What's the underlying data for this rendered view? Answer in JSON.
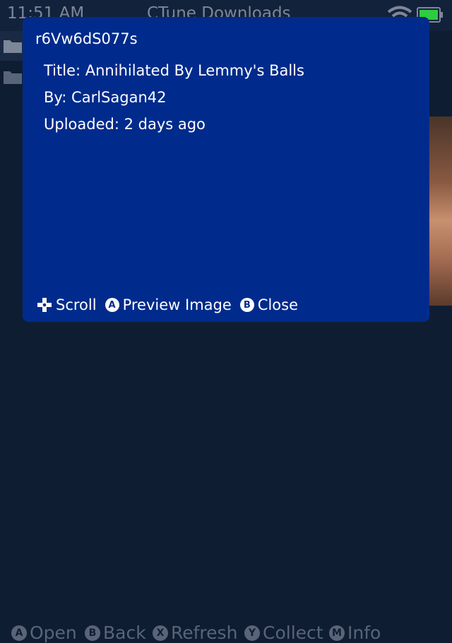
{
  "background": {
    "time": "11:51 AM",
    "title": "CTune Downloads",
    "footer_hints": [
      {
        "button": "A",
        "label": "Open"
      },
      {
        "button": "B",
        "label": "Back"
      },
      {
        "button": "X",
        "label": "Refresh"
      },
      {
        "button": "Y",
        "label": "Collect"
      },
      {
        "button": "M",
        "label": "Info"
      }
    ]
  },
  "modal": {
    "title": "r6Vw6dS077s",
    "lines": [
      "Title: Annihilated By Lemmy's Balls",
      "By: CarlSagan42",
      "Uploaded: 2 days ago"
    ],
    "hints": [
      {
        "icon": "dpad-icon",
        "button": "",
        "label": "Scroll"
      },
      {
        "icon": "a-button-icon",
        "button": "A",
        "label": "Preview Image"
      },
      {
        "icon": "b-button-icon",
        "button": "B",
        "label": "Close"
      }
    ]
  },
  "colors": {
    "modal_bg": "#002b8c",
    "app_bg": "#0f1d33",
    "battery": "#2ecc40"
  }
}
